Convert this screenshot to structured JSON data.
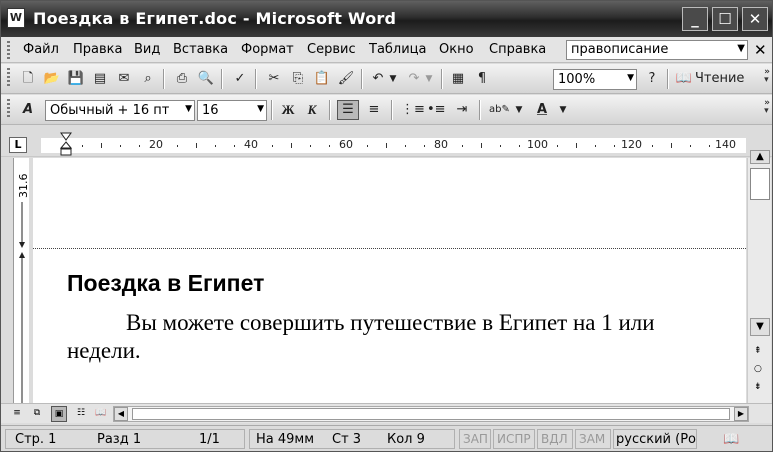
{
  "window": {
    "title": "Поездка в Египет.doc - Microsoft Word",
    "icon": "word-document-icon"
  },
  "menubar": {
    "items": [
      "Файл",
      "Правка",
      "Вид",
      "Вставка",
      "Формат",
      "Сервис",
      "Таблица",
      "Окно",
      "Справка"
    ],
    "ask_box_value": "правописание"
  },
  "standard_toolbar": {
    "zoom": "100%",
    "reading_label": "Чтение",
    "pilcrow": "¶"
  },
  "formatting_toolbar": {
    "style": "Обычный + 16 пт",
    "font_size": "16",
    "bold_label": "Ж",
    "italic_label": "К",
    "font_color_label": "А",
    "style_icon_label": "А"
  },
  "ruler": {
    "corner_label": "L",
    "labels": [
      "20",
      "40",
      "60",
      "80",
      "100",
      "120",
      "140"
    ],
    "vertical_label": "31.6"
  },
  "document": {
    "heading": "Поездка в Египет",
    "paragraph_line1": "Вы можете совершить путешествие в Египет на 1 или",
    "paragraph_line2": "недели."
  },
  "statusbar": {
    "page": "Стр. 1",
    "section": "Разд 1",
    "pages": "1/1",
    "position": "На 49мм",
    "line": "Ст 3",
    "column": "Кол 9",
    "rec": "ЗАП",
    "trk": "ИСПР",
    "ext": "ВДЛ",
    "ovr": "ЗАМ",
    "language": "русский (Ро"
  }
}
